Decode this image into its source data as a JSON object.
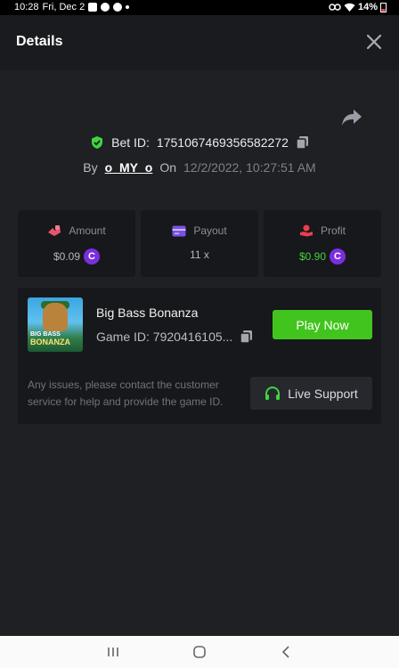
{
  "status_bar": {
    "time": "10:28",
    "date": "Fri, Dec 2",
    "battery": "14%"
  },
  "header": {
    "title": "Details"
  },
  "bet": {
    "label": "Bet ID:",
    "id": "1751067469356582272"
  },
  "byline": {
    "by_label": "By",
    "user": "o_MY_o",
    "on_label": "On",
    "datetime": "12/2/2022, 10:27:51 AM"
  },
  "stats": {
    "amount": {
      "label": "Amount",
      "value": "$0.09"
    },
    "payout": {
      "label": "Payout",
      "value": "11 x"
    },
    "profit": {
      "label": "Profit",
      "value": "$0.90"
    }
  },
  "game": {
    "name": "Big Bass Bonanza",
    "id_text": "Game ID: 7920416105...",
    "thumb_line1": "BIG BASS",
    "thumb_line2": "BONANZA",
    "play_label": "Play Now"
  },
  "support": {
    "message": "Any issues, please contact the customer service for help and provide the game ID.",
    "button_label": "Live Support"
  },
  "colors": {
    "accent_green": "#42c41e",
    "profit_green": "#3fd43f",
    "coin_purple": "#7b2ee0"
  },
  "icons": [
    "shield-check-icon",
    "copy-icon",
    "share-icon",
    "close-icon",
    "amount-icon",
    "payout-card-icon",
    "profit-icon",
    "coin-icon",
    "headset-icon"
  ]
}
